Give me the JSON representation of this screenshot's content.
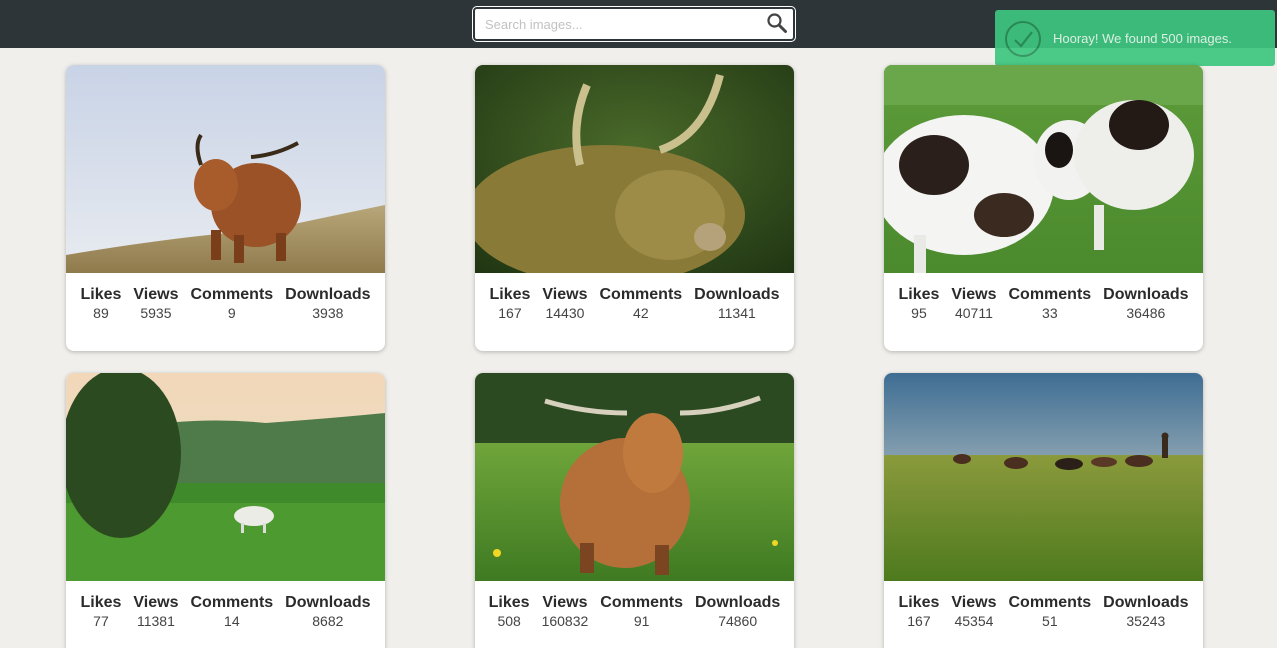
{
  "search": {
    "placeholder": "Search images..."
  },
  "toast": {
    "message": "Hooray! We found 500 images."
  },
  "stat_labels": {
    "likes": "Likes",
    "views": "Views",
    "comments": "Comments",
    "downloads": "Downloads"
  },
  "cards": [
    {
      "subject": "highland-cattle-hill",
      "likes": "89",
      "views": "5935",
      "comments": "9",
      "downloads": "3938"
    },
    {
      "subject": "highland-bull-closeup",
      "likes": "167",
      "views": "14430",
      "comments": "42",
      "downloads": "11341"
    },
    {
      "subject": "spotted-cows-pasture",
      "likes": "95",
      "views": "40711",
      "comments": "33",
      "downloads": "36486"
    },
    {
      "subject": "white-cow-meadow",
      "likes": "77",
      "views": "11381",
      "comments": "14",
      "downloads": "8682"
    },
    {
      "subject": "highland-cow-flowers",
      "likes": "508",
      "views": "160832",
      "comments": "91",
      "downloads": "74860"
    },
    {
      "subject": "cattle-herd-grassland",
      "likes": "167",
      "views": "45354",
      "comments": "51",
      "downloads": "35243"
    }
  ],
  "colors": {
    "header": "#2e3538",
    "background": "#f0efeb",
    "toast": "#3ec67f",
    "card": "#ffffff"
  }
}
